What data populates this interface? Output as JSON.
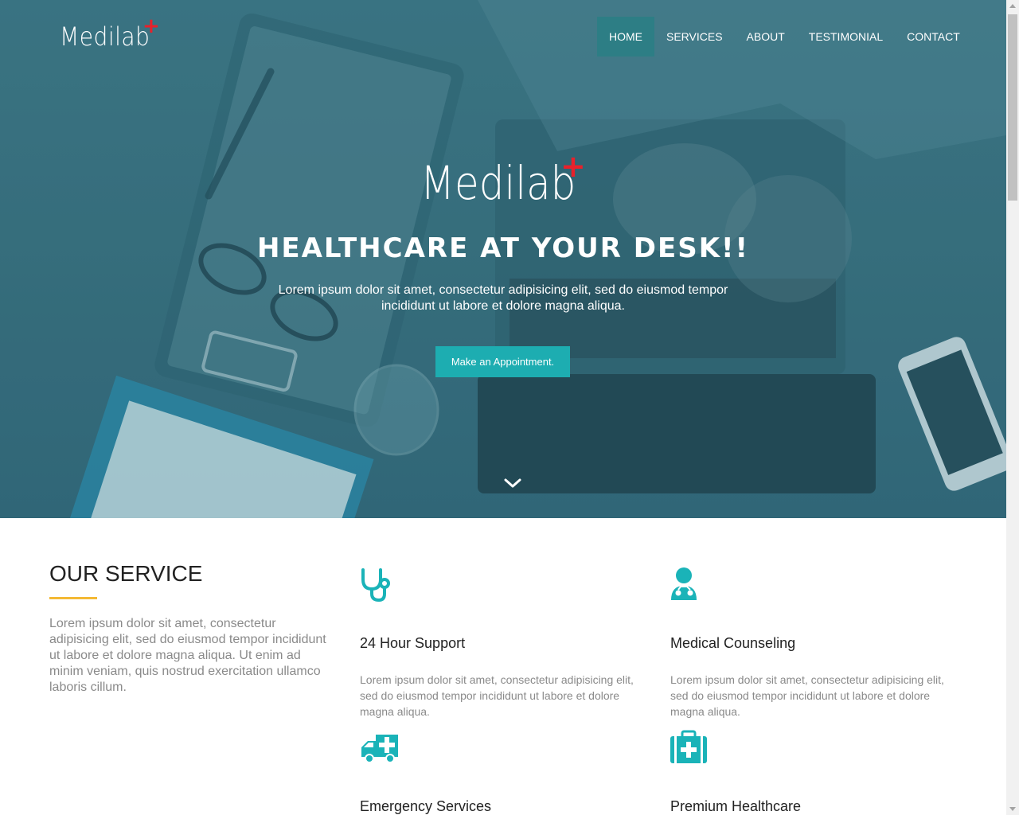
{
  "nav": {
    "logo": "Medilab",
    "logo_mark": "+",
    "items": [
      {
        "label": "HOME",
        "active": true
      },
      {
        "label": "SERVICES",
        "active": false
      },
      {
        "label": "ABOUT",
        "active": false
      },
      {
        "label": "TESTIMONIAL",
        "active": false
      },
      {
        "label": "CONTACT",
        "active": false
      }
    ]
  },
  "hero": {
    "logo": "Medilab",
    "logo_mark": "+",
    "title": "HEALTHCARE AT YOUR DESK!!",
    "subtitle": "Lorem ipsum dolor sit amet, consectetur adipisicing elit, sed do eiusmod tempor incididunt ut labore et dolore magna aliqua.",
    "cta_label": "Make an Appointment.",
    "scroll_icon": "chevron-down-icon"
  },
  "services": {
    "heading": "OUR SERVICE",
    "intro": "Lorem ipsum dolor sit amet, consectetur adipisicing elit, sed do eiusmod tempor incididunt ut labore et dolore magna aliqua. Ut enim ad minim veniam, quis nostrud exercitation ullamco laboris cillum.",
    "items": [
      {
        "icon": "stethoscope-icon",
        "title": "24 Hour Support",
        "desc": "Lorem ipsum dolor sit amet, consectetur adipisicing elit, sed do eiusmod tempor incididunt ut labore et dolore magna aliqua."
      },
      {
        "icon": "doctor-icon",
        "title": "Medical Counseling",
        "desc": "Lorem ipsum dolor sit amet, consectetur adipisicing elit, sed do eiusmod tempor incididunt ut labore et dolore magna aliqua."
      },
      {
        "icon": "ambulance-icon",
        "title": "Emergency Services",
        "desc": ""
      },
      {
        "icon": "medical-kit-icon",
        "title": "Premium Healthcare",
        "desc": ""
      }
    ]
  },
  "colors": {
    "accent": "#1dadb1",
    "nav_active": "#2d7e85",
    "icon": "#1ab3b8",
    "underline": "#f4b935",
    "logo_plus": "#e8212b",
    "hero_overlay": "#3a6f7d"
  }
}
